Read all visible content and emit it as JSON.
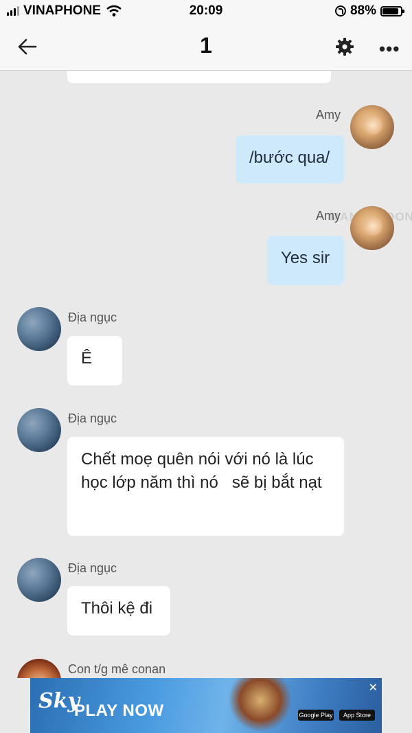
{
  "status_bar": {
    "carrier": "VINAPHONE",
    "time": "20:09",
    "battery_percent": "88%",
    "battery_level": 0.88
  },
  "header": {
    "title": "1",
    "back_icon": "arrow-left-icon",
    "settings_icon": "gear-icon",
    "more_icon": "more-dots-icon",
    "more_glyph": "•••"
  },
  "messages": [
    {
      "sender": "Amy",
      "text": "/bước qua/"
    },
    {
      "sender": "Amy",
      "text": "Yes sir"
    },
    {
      "sender": "Địa ngục",
      "text": "Ê"
    },
    {
      "sender": "Địa ngục",
      "text": "Chết moẹ quên nói với nó là lúc học lớp năm thì nó   sẽ bị bắt nạt"
    },
    {
      "sender": "Địa ngục",
      "text": "Thôi kệ đi"
    },
    {
      "sender": "Con t/g mê conan",
      "text": ""
    }
  ],
  "watermark": "MANGOTOON",
  "ad": {
    "logo": "Sky",
    "cta": "PLAY NOW",
    "close": "✕",
    "google_play": "Google Play",
    "app_store": "App Store"
  },
  "colors": {
    "background": "#e9e9e9",
    "my_bubble": "#cde9fb",
    "their_bubble": "#ffffff"
  }
}
